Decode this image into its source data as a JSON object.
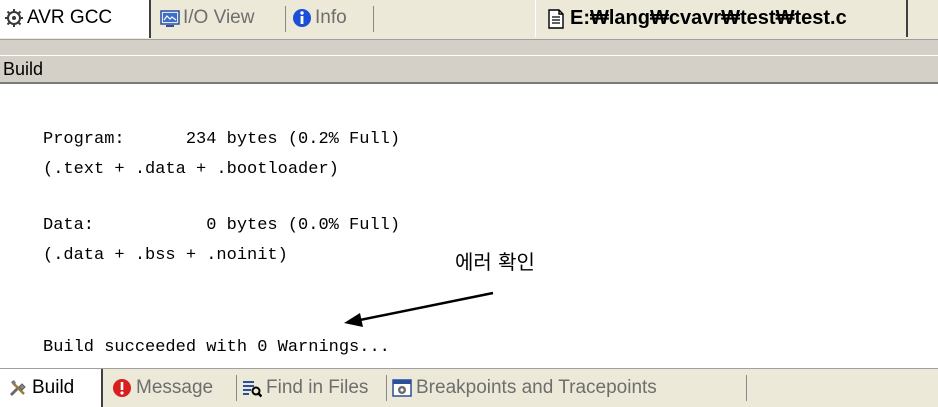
{
  "top_tabs": {
    "avr_gcc": "AVR GCC",
    "io_view": "I/O View",
    "info": "Info",
    "file": "E:₩lang₩cvavr₩test₩test.c"
  },
  "panel": {
    "title": "Build"
  },
  "output": {
    "lines": [
      "Program:      234 bytes (0.2% Full)",
      "(.text + .data + .bootloader)",
      "Data:           0 bytes (0.0% Full)",
      "(.data + .bss + .noinit)",
      "Build succeeded with 0 Warnings..."
    ],
    "annotation": "에러 확인"
  },
  "bottom_tabs": {
    "build": "Build",
    "message": "Message",
    "find_in_files": "Find in Files",
    "breakpoints": "Breakpoints and Tracepoints"
  },
  "icons": {
    "avr": "avr-gcc-icon",
    "io": "io-view-icon",
    "info": "info-icon",
    "file": "document-icon",
    "build": "build-tools-icon",
    "message": "error-message-icon",
    "find": "find-in-files-icon",
    "breakpoints": "breakpoints-icon"
  },
  "colors": {
    "info_blue": "#1a4fd6",
    "message_red": "#d81e1e",
    "tab_bar_bg": "#ece9d8"
  }
}
